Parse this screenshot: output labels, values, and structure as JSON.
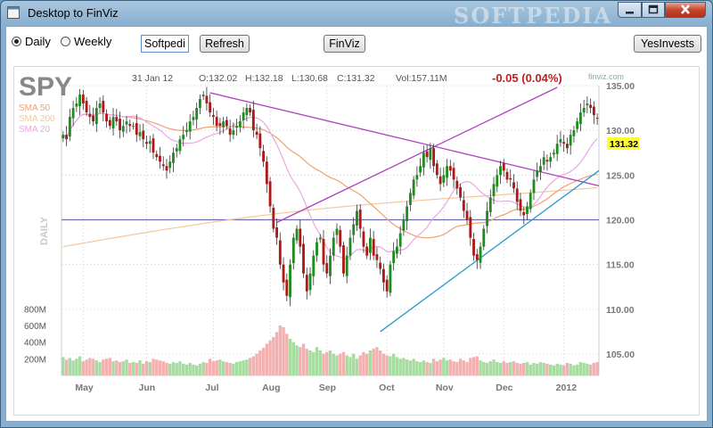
{
  "window": {
    "title": "Desktop to FinViz",
    "watermark": "SOFTPEDIA"
  },
  "toolbar": {
    "daily_label": "Daily",
    "weekly_label": "Weekly",
    "period_selected": "Daily",
    "ticker_value": "Softpedi",
    "refresh_label": "Refresh",
    "finviz_label": "FinViz",
    "yesinvests_label": "YesInvests"
  },
  "chart_data": {
    "type": "candlestick",
    "ticker": "SPY",
    "date": "31 Jan 12",
    "ohlc_text": {
      "open": "O:132.02",
      "high": "H:132.18",
      "low": "L:130.68",
      "close": "C:131.32",
      "volume": "Vol:157.11M"
    },
    "change": "-0.05 (0.04%)",
    "source": "finviz.com",
    "period_label": "DAILY",
    "last_price_label": "131.32",
    "last_price": 131.32,
    "y_range": [
      105,
      135
    ],
    "y_ticks": [
      "135.00",
      "130.00",
      "125.00",
      "120.00",
      "115.00",
      "110.00",
      "105.00"
    ],
    "x_labels": [
      "May",
      "Jun",
      "Jul",
      "Aug",
      "Sep",
      "Oct",
      "Nov",
      "Dec",
      "2012"
    ],
    "volume_ticks": [
      "800M",
      "600M",
      "400M",
      "200M"
    ],
    "legend": [
      {
        "name": "SMA 50",
        "color": "#f0a070"
      },
      {
        "name": "SMA 200",
        "color": "#f5c89a"
      },
      {
        "name": "SMA 20",
        "color": "#e8a8e0"
      }
    ],
    "horizontal_level": 120.0,
    "close_series": [
      129.5,
      129.0,
      131.5,
      132.5,
      133.0,
      134.0,
      133.0,
      132.0,
      131.5,
      131.0,
      132.5,
      133.0,
      132.0,
      131.0,
      130.5,
      131.5,
      131.0,
      130.0,
      130.5,
      131.0,
      130.5,
      130.5,
      129.5,
      129.8,
      129.0,
      128.5,
      128.8,
      127.5,
      127.0,
      126.5,
      126.0,
      125.5,
      126.5,
      127.5,
      128.0,
      129.0,
      129.5,
      130.0,
      131.0,
      131.5,
      132.5,
      133.5,
      134.0,
      133.0,
      132.0,
      131.5,
      130.5,
      130.5,
      131.0,
      130.5,
      129.5,
      130.0,
      130.5,
      131.0,
      132.0,
      132.5,
      132.0,
      130.0,
      129.5,
      128.0,
      126.5,
      124.0,
      121.5,
      119.0,
      118.0,
      115.0,
      113.0,
      111.5,
      115.0,
      118.0,
      119.0,
      117.0,
      114.0,
      112.0,
      114.0,
      116.0,
      117.5,
      118.0,
      115.0,
      114.0,
      116.0,
      118.0,
      119.0,
      117.0,
      114.0,
      116.0,
      118.0,
      119.5,
      121.0,
      119.0,
      117.0,
      116.0,
      118.0,
      116.0,
      115.5,
      114.5,
      113.0,
      112.0,
      115.0,
      116.5,
      117.0,
      118.5,
      120.0,
      121.5,
      123.0,
      124.5,
      125.0,
      126.0,
      127.5,
      127.0,
      128.0,
      126.0,
      125.0,
      124.0,
      125.0,
      126.0,
      125.5,
      124.5,
      123.5,
      122.5,
      121.0,
      120.0,
      118.0,
      116.0,
      115.5,
      117.0,
      119.0,
      121.0,
      122.5,
      124.0,
      125.0,
      126.0,
      125.5,
      124.5,
      124.5,
      123.5,
      122.0,
      121.0,
      120.5,
      121.5,
      123.0,
      124.5,
      125.5,
      126.0,
      127.0,
      126.5,
      127.0,
      127.5,
      128.5,
      129.0,
      128.5,
      128.0,
      129.5,
      130.0,
      131.0,
      132.0,
      132.5,
      133.0,
      132.5,
      131.7,
      131.32
    ],
    "volume_series": [
      220,
      190,
      210,
      180,
      200,
      230,
      170,
      190,
      210,
      200,
      180,
      160,
      190,
      200,
      210,
      170,
      180,
      160,
      170,
      190,
      150,
      160,
      150,
      180,
      140,
      170,
      160,
      200,
      190,
      180,
      170,
      150,
      140,
      160,
      150,
      170,
      140,
      130,
      150,
      130,
      120,
      140,
      160,
      150,
      200,
      170,
      180,
      190,
      170,
      160,
      150,
      140,
      160,
      170,
      180,
      190,
      210,
      230,
      260,
      300,
      330,
      380,
      420,
      460,
      520,
      600,
      580,
      500,
      440,
      400,
      360,
      340,
      380,
      320,
      300,
      280,
      340,
      300,
      260,
      280,
      300,
      260,
      240,
      260,
      280,
      240,
      220,
      260,
      200,
      240,
      280,
      260,
      300,
      320,
      340,
      300,
      260,
      240,
      230,
      260,
      220,
      200,
      210,
      190,
      180,
      200,
      170,
      160,
      180,
      160,
      150,
      200,
      170,
      190,
      210,
      180,
      190,
      170,
      160,
      200,
      180,
      160,
      210,
      220,
      230,
      180,
      160,
      150,
      170,
      190,
      160,
      150,
      170,
      150,
      160,
      170,
      150,
      140,
      150,
      160,
      130,
      150,
      140,
      160,
      150,
      140,
      130,
      120,
      140,
      130,
      120,
      150,
      140,
      120,
      130,
      160,
      150,
      140,
      130,
      150,
      160,
      140,
      157
    ]
  }
}
